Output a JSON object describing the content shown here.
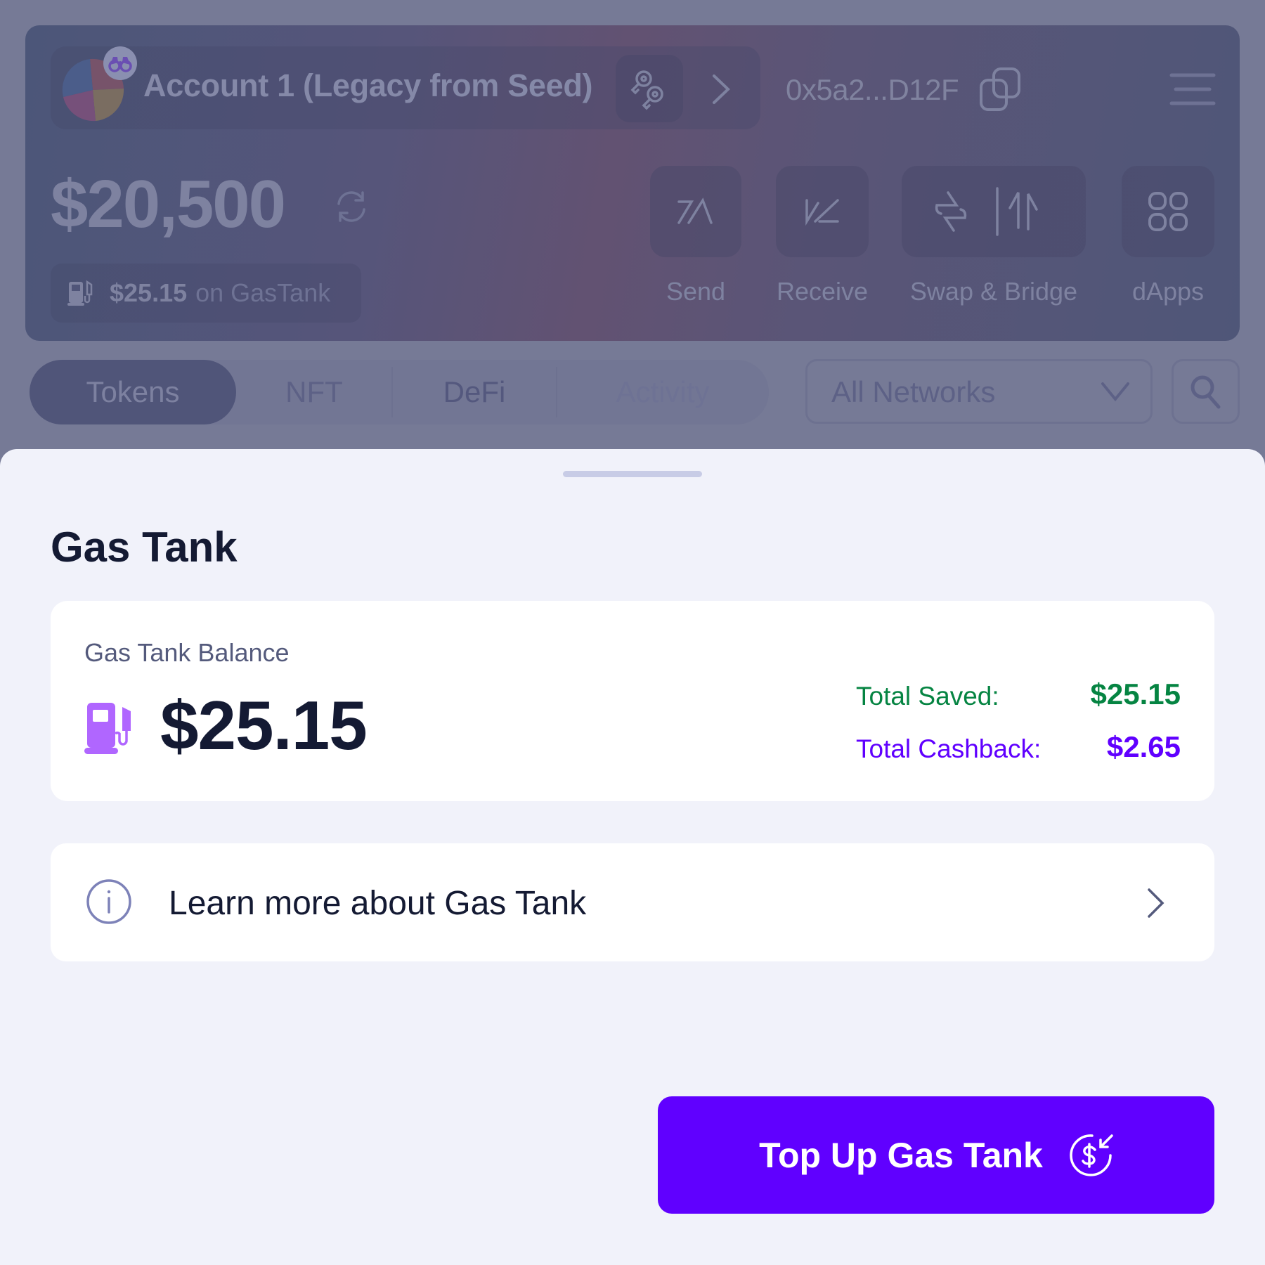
{
  "dashboard": {
    "account": {
      "name": "Account 1 (Legacy from Seed)",
      "address": "0x5a2...D12F",
      "avatar_icon": "pie-avatar-icon",
      "badge_icon": "binoculars-icon"
    },
    "balance": "$20,500",
    "gas_tank_pill": {
      "amount": "$25.15",
      "suffix": "on GasTank"
    },
    "actions": [
      {
        "label": "Send",
        "icon": "send-arrow-icon"
      },
      {
        "label": "Receive",
        "icon": "receive-arrow-icon"
      },
      {
        "label": "Swap & Bridge",
        "icon": "swap-bridge-icon"
      },
      {
        "label": "dApps",
        "icon": "grid-icon"
      }
    ],
    "tabs": [
      {
        "label": "Tokens",
        "active": true
      },
      {
        "label": "NFT",
        "active": false
      },
      {
        "label": "DeFi",
        "active": false
      },
      {
        "label": "Activity",
        "active": false
      }
    ],
    "network_select": {
      "selected": "All Networks"
    }
  },
  "sheet": {
    "title": "Gas Tank",
    "balance_card": {
      "label": "Gas Tank Balance",
      "amount": "$25.15",
      "stats": [
        {
          "label": "Total Saved:",
          "value": "$25.15",
          "color": "#058442"
        },
        {
          "label": "Total Cashback:",
          "value": "$2.65",
          "color": "#6000ff"
        }
      ]
    },
    "learn_more": {
      "label": "Learn more about Gas Tank"
    },
    "top_up_button": {
      "label": "Top Up Gas Tank"
    }
  },
  "colors": {
    "primary": "#6000ff",
    "success": "#058442",
    "pump_icon": "#b066ff",
    "text_dark": "#141a33"
  }
}
